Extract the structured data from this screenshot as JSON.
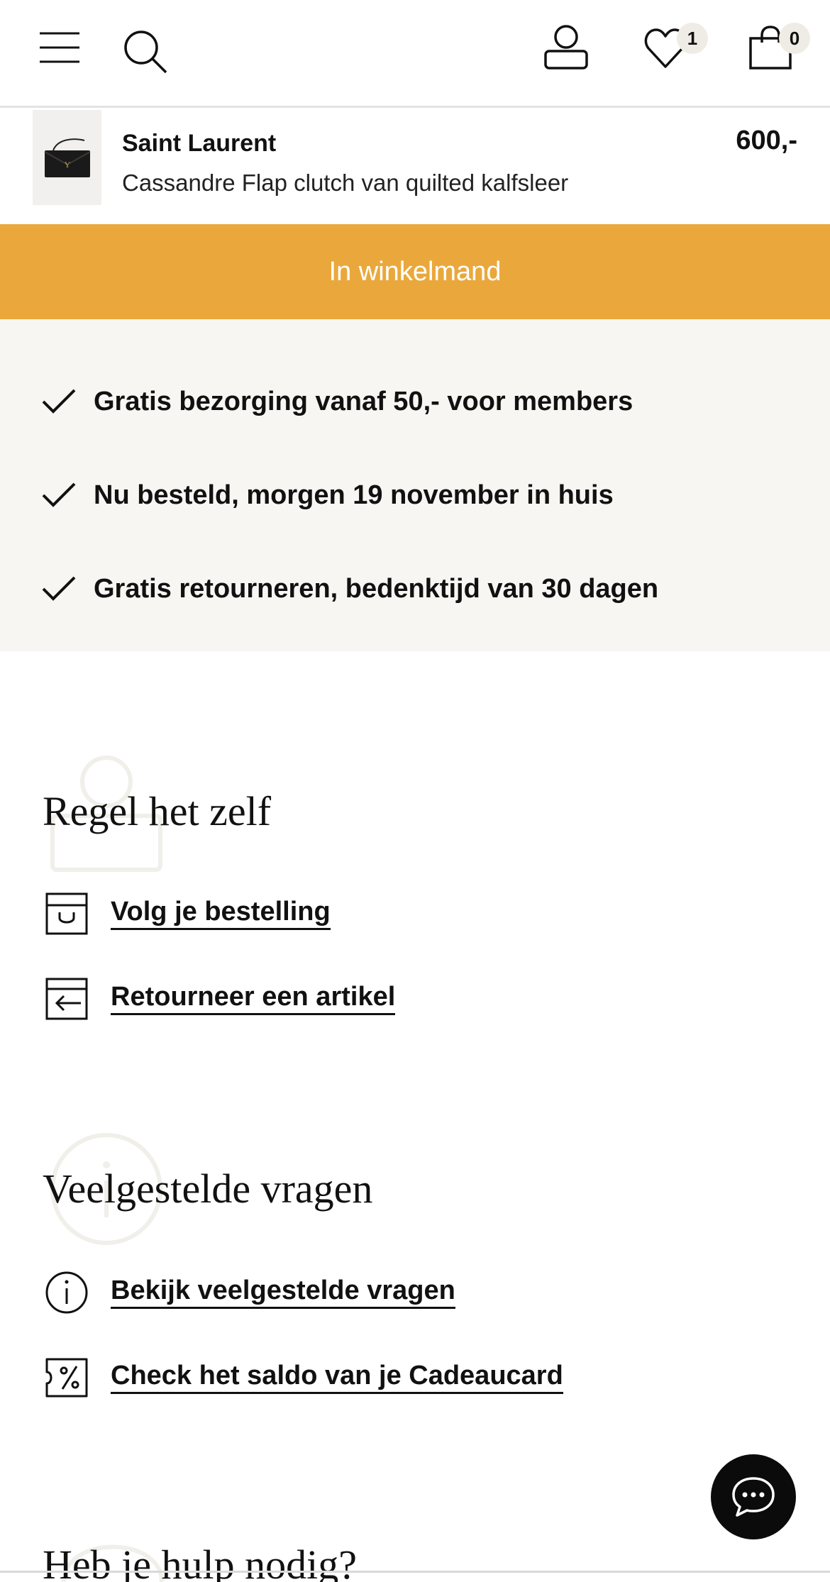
{
  "header": {
    "menu_icon": "hamburger-icon",
    "search_icon": "search-icon",
    "account_icon": "user-icon",
    "wishlist_icon": "heart-icon",
    "wishlist_count": "1",
    "cart_icon": "shopping-bag-icon",
    "cart_count": "0"
  },
  "product": {
    "brand": "Saint Laurent",
    "name": "Cassandre Flap clutch van quilted kalfsleer",
    "price": "600,-",
    "thumbnail_icon": "clutch-bag-image"
  },
  "cart_button": {
    "label": "In winkelmand",
    "color": "#eaa83c"
  },
  "usp": [
    {
      "text": "Gratis bezorging vanaf 50,- voor members",
      "icon": "check-icon"
    },
    {
      "text": "Nu besteld, morgen 19 november in huis",
      "icon": "check-icon"
    },
    {
      "text": "Gratis retourneren, bedenktijd van 30 dagen",
      "icon": "check-icon"
    }
  ],
  "self_service": {
    "title": "Regel het zelf",
    "links": [
      {
        "label": "Volg je bestelling",
        "icon": "package-icon"
      },
      {
        "label": "Retourneer een artikel",
        "icon": "return-icon"
      }
    ]
  },
  "faq": {
    "title": "Veelgestelde vragen",
    "links": [
      {
        "label": "Bekijk veelgestelde vragen",
        "icon": "info-icon"
      },
      {
        "label": "Check het saldo van je Cadeaucard",
        "icon": "voucher-icon"
      }
    ]
  },
  "help": {
    "title": "Heb je hulp nodig?"
  },
  "chat": {
    "icon": "chat-icon"
  }
}
